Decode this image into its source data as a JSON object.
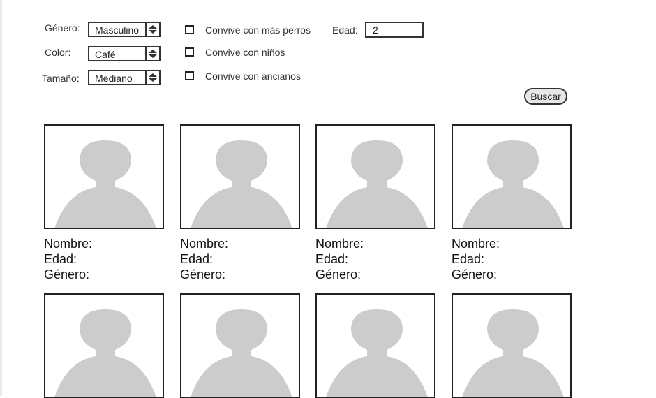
{
  "filters": {
    "genero": {
      "label": "Género:",
      "value": "Masculino"
    },
    "color": {
      "label": "Color:",
      "value": "Café"
    },
    "tamano": {
      "label": "Tamaño:",
      "value": "Mediano"
    },
    "checkboxes": [
      {
        "label": "Convive con más perros",
        "checked": false
      },
      {
        "label": "Convive con niños",
        "checked": false
      },
      {
        "label": "Convive con ancianos",
        "checked": false
      }
    ],
    "edad": {
      "label": "Edad:",
      "value": "2"
    },
    "search_button": "Buscar"
  },
  "results": {
    "nombre_label": "Nombre:",
    "edad_label": "Edad:",
    "genero_label": "Género:"
  },
  "colors": {
    "avatar_fill": "#cccccc",
    "border": "#222222",
    "button_bg": "#e6e6e6"
  }
}
